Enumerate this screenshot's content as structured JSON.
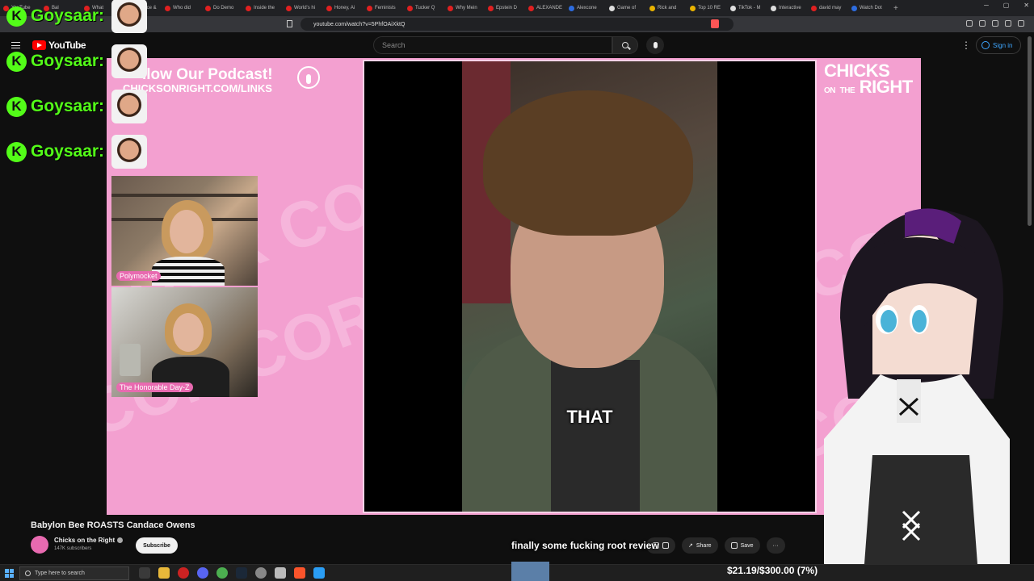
{
  "browser": {
    "tabs": [
      {
        "label": "YouTube",
        "fav": "red"
      },
      {
        "label": "Bal",
        "fav": "red"
      },
      {
        "label": "What",
        "fav": "red"
      },
      {
        "label": "Candace &",
        "fav": "red"
      },
      {
        "label": "Who did",
        "fav": "red"
      },
      {
        "label": "Do Demo",
        "fav": "red"
      },
      {
        "label": "Inside the",
        "fav": "red"
      },
      {
        "label": "World's hi",
        "fav": "red"
      },
      {
        "label": "Honey, Ai",
        "fav": "red"
      },
      {
        "label": "Feminists",
        "fav": "red"
      },
      {
        "label": "Tucker Q",
        "fav": "red"
      },
      {
        "label": "Why Mein",
        "fav": "red"
      },
      {
        "label": "Epstein D",
        "fav": "red"
      },
      {
        "label": "ALEXANDE",
        "fav": "red"
      },
      {
        "label": "Alexcone",
        "fav": "blue"
      },
      {
        "label": "Game of",
        "fav": "white"
      },
      {
        "label": "Rick and",
        "fav": "yellow"
      },
      {
        "label": "Top 10 RE",
        "fav": "yellow"
      },
      {
        "label": "TikTok - M",
        "fav": "white"
      },
      {
        "label": "Interactive",
        "fav": "white"
      },
      {
        "label": "david may",
        "fav": "red"
      },
      {
        "label": "Watch Dot",
        "fav": "blue"
      }
    ],
    "url": "youtube.com/watch?v=5PhfOAiXktQ"
  },
  "youtube": {
    "logo_text": "YouTube",
    "search_placeholder": "Search",
    "sign_in": "Sign in"
  },
  "chat": {
    "badge": "K",
    "messages": [
      {
        "user": "Goysaar:"
      },
      {
        "user": "Goysaar:"
      },
      {
        "user": "Goysaar:"
      },
      {
        "user": "Goysaar:"
      }
    ]
  },
  "stream": {
    "podcast_title": "llow Our Podcast!",
    "podcast_link": "CHICKSONRIGHT.COM/LINKS",
    "brand_line1": "CHICKS",
    "brand_line2": "ON",
    "brand_line3": "THE",
    "brand_line4": "RIGHT",
    "cam1_label": "Polymocket",
    "cam2_label": "The Honorable Day-Z",
    "caption": "THAT"
  },
  "video": {
    "title": "Babylon Bee ROASTS Candace Owens",
    "channel": "Chicks on the Right",
    "subscribers": "147K subscribers",
    "subscribe_label": "Subscribe",
    "share_label": "Share",
    "save_label": "Save"
  },
  "overlay": {
    "subtitle": "finally some fucking root review",
    "donation": "$21.19/$300.00 (7%)"
  },
  "taskbar": {
    "search_placeholder": "Type here to search"
  }
}
